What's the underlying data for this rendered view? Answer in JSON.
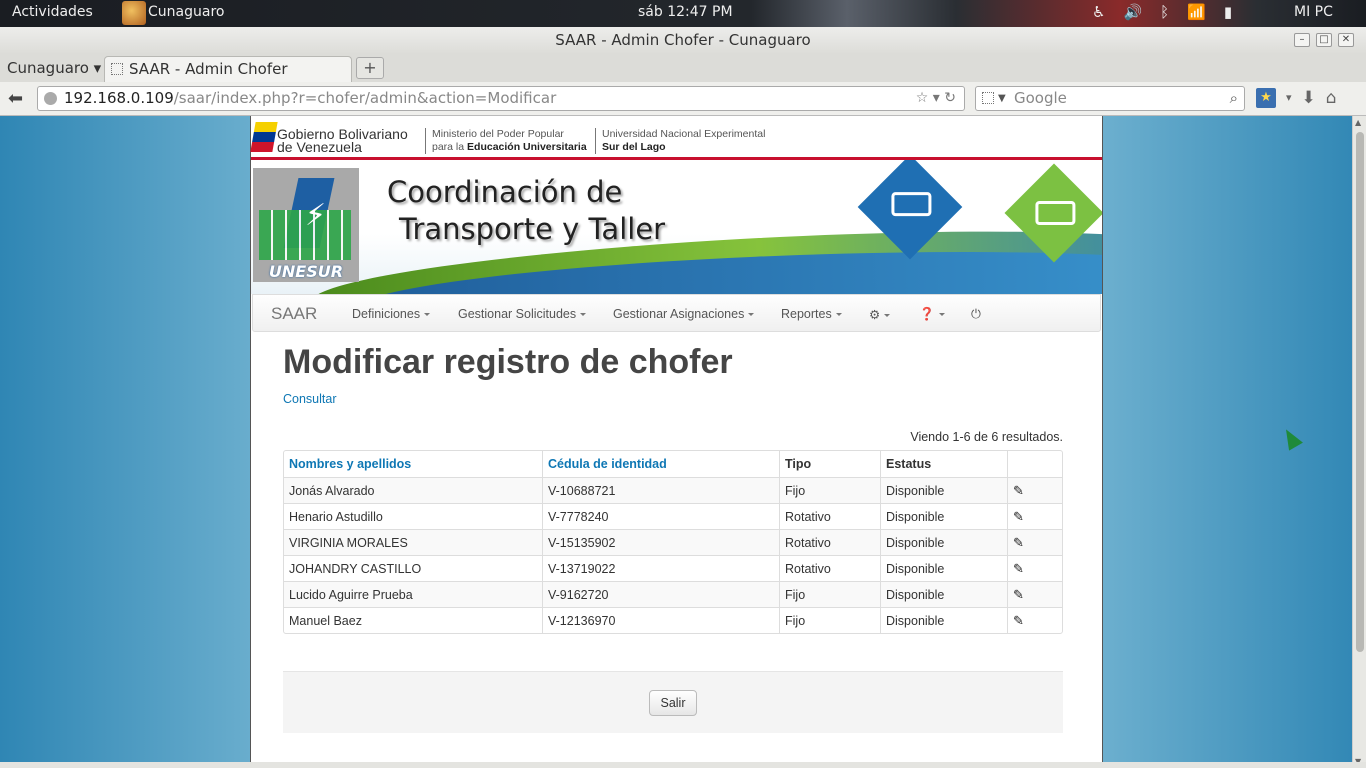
{
  "system": {
    "activities": "Actividades",
    "app_name": "Cunaguaro",
    "clock": "sáb 12:47 PM",
    "user": "MI PC"
  },
  "window": {
    "title": "SAAR - Admin Chofer - Cunaguaro"
  },
  "browser": {
    "tab_group": "Cunaguaro ▾",
    "tab_title": "SAAR - Admin Chofer",
    "url_host": "192.168.0.109",
    "url_path": "/saar/index.php?r=chofer/admin&action=Modificar",
    "search_placeholder": "Google"
  },
  "header": {
    "gov_line1": "Gobierno Bolivariano",
    "gov_line2": "de Venezuela",
    "ministry_line1": "Ministerio del Poder Popular",
    "ministry_line2_prefix": "para la",
    "ministry_line2_bold": "Educación Universitaria",
    "uni_line1": "Universidad Nacional Experimental",
    "uni_line2": "Sur del Lago",
    "banner_title_1": "Coordinación de",
    "banner_title_2": "Transporte y Taller",
    "logo_text": "UNESUR"
  },
  "menu": {
    "brand": "SAAR",
    "items": [
      "Definiciones",
      "Gestionar Solicitudes",
      "Gestionar Asignaciones",
      "Reportes"
    ]
  },
  "main": {
    "title": "Modificar registro de chofer",
    "link": "Consultar",
    "summary": "Viendo 1-6 de 6 resultados.",
    "columns": [
      "Nombres y apellidos",
      "Cédula de identidad",
      "Tipo",
      "Estatus"
    ],
    "rows": [
      [
        "Jonás Alvarado",
        "V-10688721",
        "Fijo",
        "Disponible"
      ],
      [
        "Henario Astudillo",
        "V-7778240",
        "Rotativo",
        "Disponible"
      ],
      [
        "VIRGINIA MORALES",
        "V-15135902",
        "Rotativo",
        "Disponible"
      ],
      [
        "JOHANDRY CASTILLO",
        "V-13719022",
        "Rotativo",
        "Disponible"
      ],
      [
        "Lucido Aguirre Prueba",
        "V-9162720",
        "Fijo",
        "Disponible"
      ],
      [
        "Manuel Baez",
        "V-12136970",
        "Fijo",
        "Disponible"
      ]
    ],
    "exit_button": "Salir"
  },
  "colors": {
    "link": "#0e77b4",
    "flag_red": "#c8102e"
  }
}
